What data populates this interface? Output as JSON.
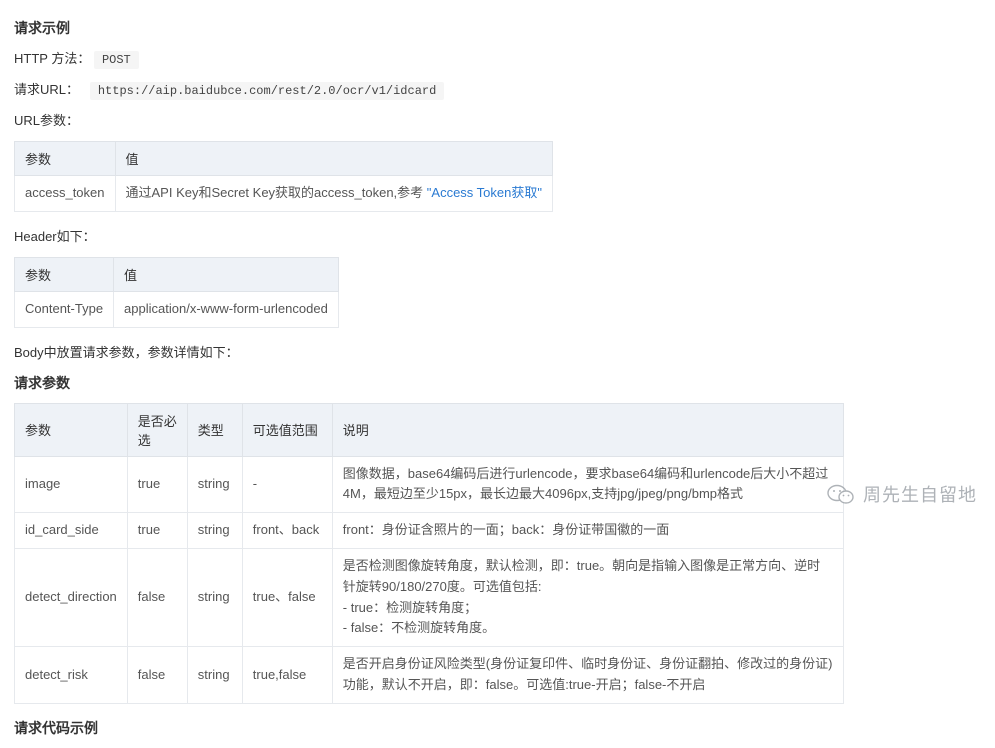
{
  "titles": {
    "request_example": "请求示例",
    "request_params": "请求参数"
  },
  "http_method": {
    "label": "HTTP 方法：",
    "value": "POST"
  },
  "request_url": {
    "label": "请求URL：",
    "value": "https://aip.baidubce.com/rest/2.0/ocr/v1/idcard"
  },
  "url_params_heading": "URL参数：",
  "url_params_table": {
    "headers": [
      "参数",
      "值"
    ],
    "row": {
      "param": "access_token",
      "value_prefix": "通过API Key和Secret Key获取的access_token,参考",
      "value_link": "\"Access Token获取\""
    }
  },
  "header_heading": "Header如下：",
  "header_table": {
    "headers": [
      "参数",
      "值"
    ],
    "row": {
      "param": "Content-Type",
      "value": "application/x-www-form-urlencoded"
    }
  },
  "body_note": "Body中放置请求参数，参数详情如下：",
  "params_table": {
    "headers": [
      "参数",
      "是否必选",
      "类型",
      "可选值范围",
      "说明"
    ],
    "rows": [
      {
        "param": "image",
        "required": "true",
        "type": "string",
        "range": "-",
        "desc": "图像数据，base64编码后进行urlencode，要求base64编码和urlencode后大小不超过4M，最短边至少15px，最长边最大4096px,支持jpg/jpeg/png/bmp格式"
      },
      {
        "param": "id_card_side",
        "required": "true",
        "type": "string",
        "range": "front、back",
        "desc": "front：身份证含照片的一面；back：身份证带国徽的一面"
      },
      {
        "param": "detect_direction",
        "required": "false",
        "type": "string",
        "range": "true、false",
        "desc": "是否检测图像旋转角度，默认检测，即：true。朝向是指输入图像是正常方向、逆时针旋转90/180/270度。可选值包括:\n- true：检测旋转角度；\n- false：不检测旋转角度。"
      },
      {
        "param": "detect_risk",
        "required": "false",
        "type": "string",
        "range": "true,false",
        "desc": "是否开启身份证风险类型(身份证复印件、临时身份证、身份证翻拍、修改过的身份证)功能，默认不开启，即：false。可选值:true-开启；false-不开启"
      }
    ]
  },
  "bottom_heading": "请求代码示例",
  "watermark": "周先生自留地"
}
